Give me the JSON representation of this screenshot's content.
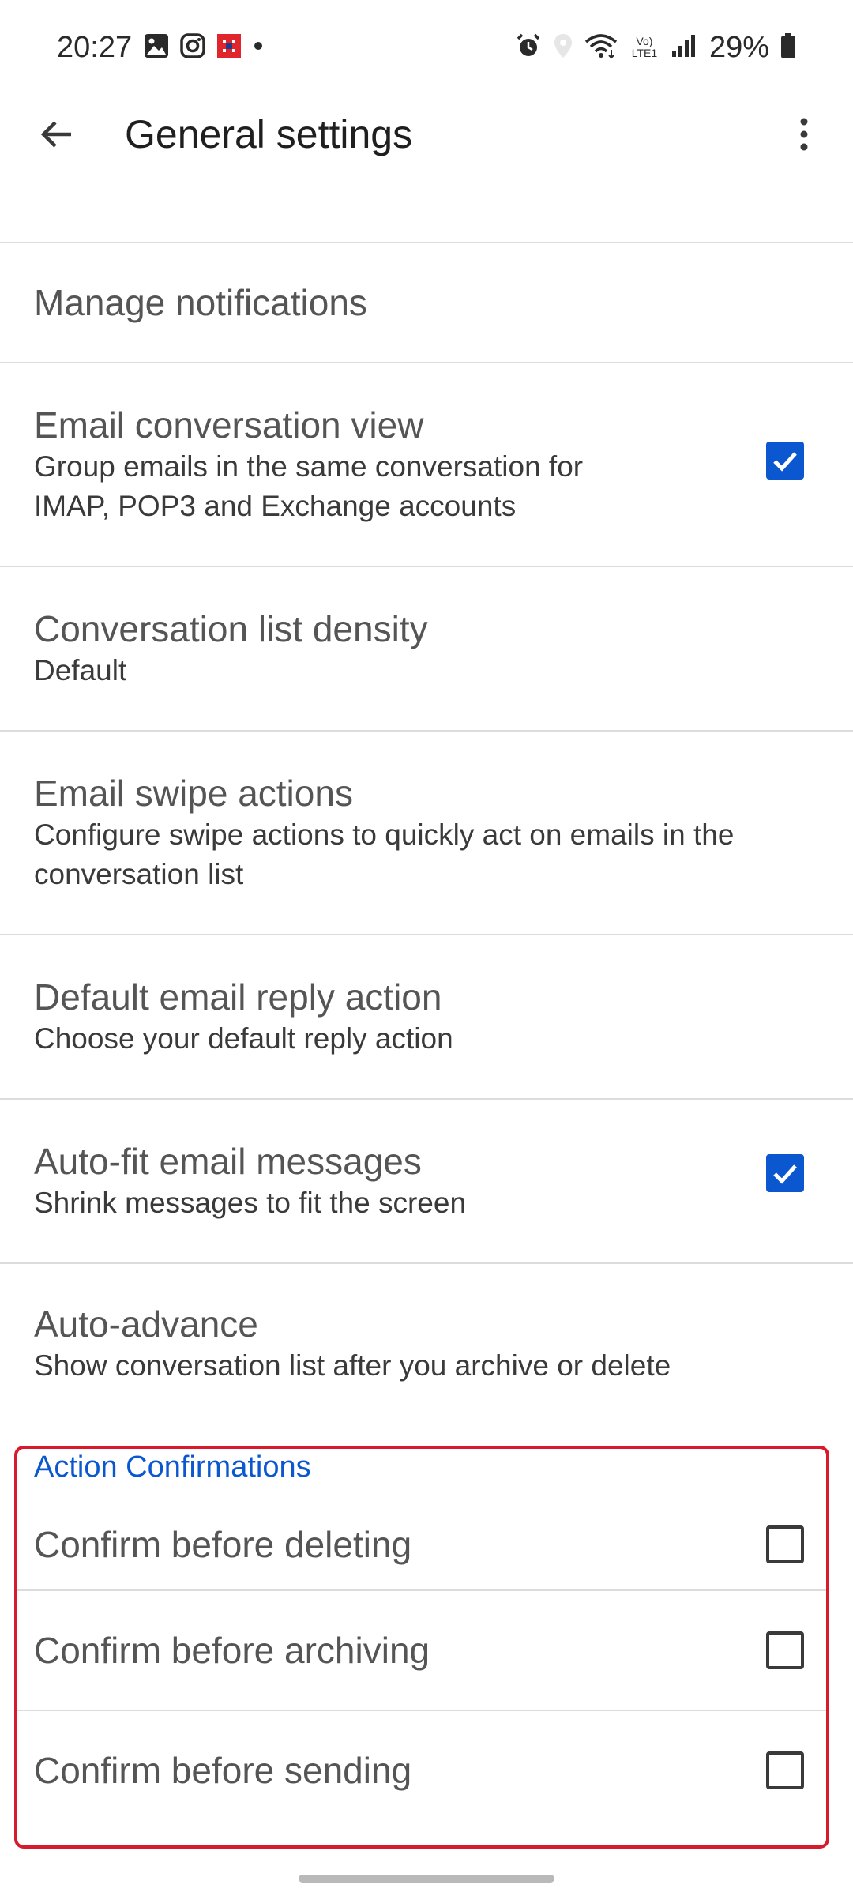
{
  "status_bar": {
    "time": "20:27",
    "battery_percent": "29%",
    "network_label": "Vo) LTE1",
    "left_icons": [
      "gallery-icon",
      "instagram-icon",
      "app-notification-icon",
      "dot-icon"
    ],
    "right_icons": [
      "alarm-icon",
      "location-icon",
      "wifi-icon",
      "volte-icon",
      "signal-icon",
      "battery-icon"
    ]
  },
  "app_bar": {
    "title": "General settings",
    "back_icon": "arrow-back-icon",
    "menu_icon": "more-vert-icon"
  },
  "settings": {
    "manage_notifications": {
      "title": "Manage notifications"
    },
    "conversation_view": {
      "title": "Email conversation view",
      "subtitle_line1": "Group emails in the same conversation for",
      "subtitle_line2": "IMAP, POP3 and Exchange accounts",
      "checked": true
    },
    "list_density": {
      "title": "Conversation list density",
      "subtitle": "Default"
    },
    "swipe_actions": {
      "title": "Email swipe actions",
      "subtitle_line1": "Configure swipe actions to quickly act on emails in the",
      "subtitle_line2": "conversation list"
    },
    "reply_action": {
      "title": "Default email reply action",
      "subtitle": "Choose your default reply action"
    },
    "auto_fit": {
      "title": "Auto-fit email messages",
      "subtitle": "Shrink messages to fit the screen",
      "checked": true
    },
    "auto_advance": {
      "title": "Auto-advance",
      "subtitle": "Show conversation list after you archive or delete"
    }
  },
  "action_confirmations": {
    "header": "Action Confirmations",
    "confirm_delete": {
      "title": "Confirm before deleting",
      "checked": false
    },
    "confirm_archive": {
      "title": "Confirm before archiving",
      "checked": false
    },
    "confirm_send": {
      "title": "Confirm before sending",
      "checked": false
    }
  },
  "colors": {
    "accent": "#0b57d0",
    "highlight": "#d81b2c",
    "divider": "#dcdcdc"
  }
}
